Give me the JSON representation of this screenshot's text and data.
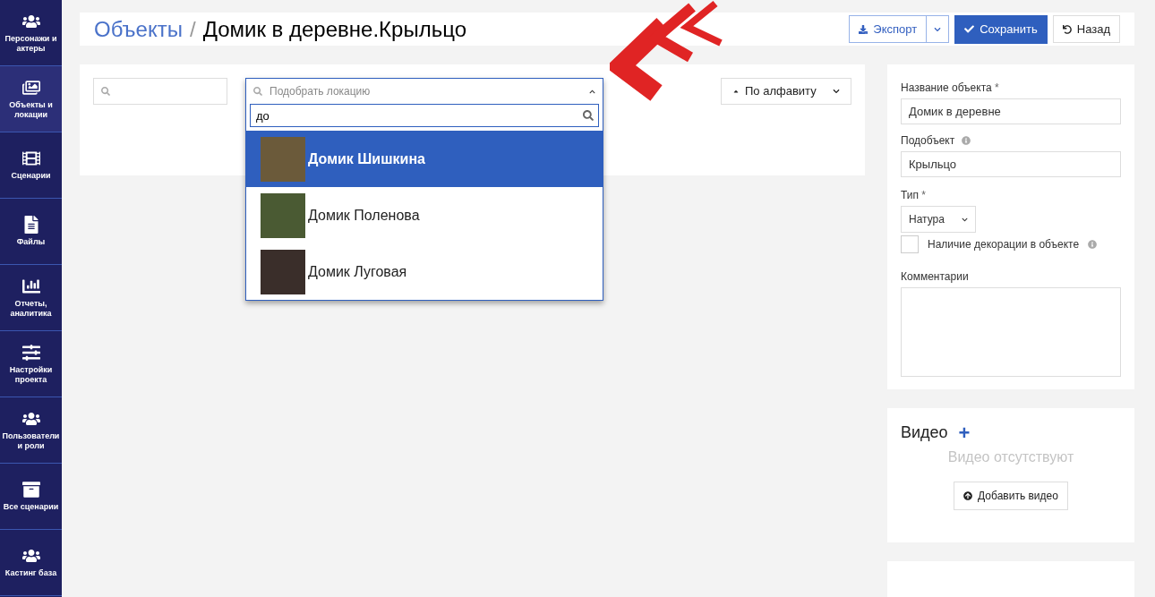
{
  "sidebar": {
    "items": [
      {
        "label": "Персонажи и актеры",
        "selected": false
      },
      {
        "label": "Объекты и локации",
        "selected": true
      },
      {
        "label": "Сценарии",
        "selected": false
      },
      {
        "label": "Файлы",
        "selected": false
      },
      {
        "label": "Отчеты, аналитика",
        "selected": false
      },
      {
        "label": "Настройки проекта",
        "selected": false
      },
      {
        "label": "Пользователи и роли",
        "selected": false
      },
      {
        "label": "Все сценарии",
        "selected": false
      },
      {
        "label": "Кастинг база",
        "selected": false
      }
    ]
  },
  "header": {
    "breadcrumb": "Объекты",
    "separator": "/",
    "title": "Домик в деревне.Крыльцо",
    "buttons": {
      "export": "Экспорт",
      "save": "Сохранить",
      "back": "Назад"
    }
  },
  "filters": {
    "location": {
      "placeholder": "Подобрать локацию",
      "expanded": true,
      "query": "до",
      "options": [
        {
          "label": "Домик Шишкина",
          "selected": true
        },
        {
          "label": "Домик Поленова",
          "selected": false
        },
        {
          "label": "Домик Луговая",
          "selected": false
        }
      ]
    },
    "sort": {
      "label": "По алфавиту"
    }
  },
  "form": {
    "name": {
      "label": "Название объекта",
      "mark": "*",
      "value": "Домик в деревне"
    },
    "subobject": {
      "label": "Подобъект",
      "value": "Крыльцо"
    },
    "type": {
      "label": "Тип",
      "mark": "*",
      "value": "Натура"
    },
    "decoration": {
      "label": "Наличие декорации в объекте",
      "checked": false
    },
    "comments": {
      "label": "Комментарии"
    }
  },
  "video": {
    "title": "Видео",
    "plus": "+",
    "empty": "Видео отсутствуют",
    "add": "Добавить видео"
  }
}
